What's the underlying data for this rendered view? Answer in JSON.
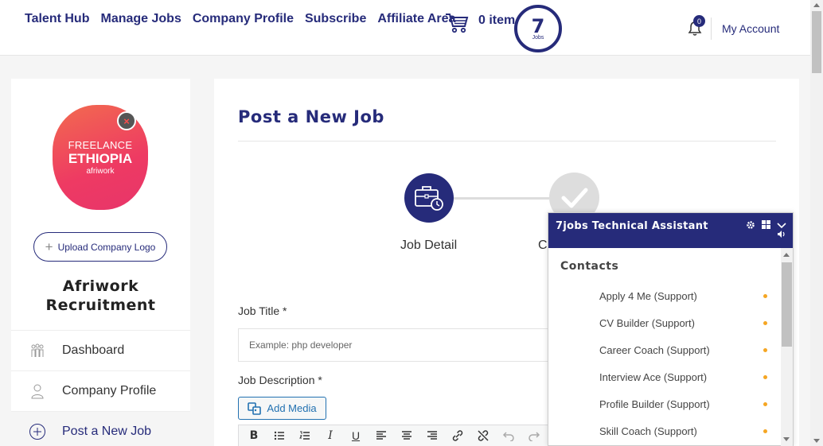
{
  "header": {
    "nav": [
      "Talent Hub",
      "Manage Jobs",
      "Company Profile",
      "Subscribe",
      "Affiliate Area"
    ],
    "cart_text": "0 item",
    "logo_number": "7",
    "logo_text": "Jobs",
    "notification_count": "0",
    "account_label": "My Account"
  },
  "sidebar": {
    "company_logo": {
      "line1": "FREELANCE",
      "line2": "ETHIOPIA",
      "line3": "afriwork"
    },
    "remove_logo_symbol": "×",
    "upload_button": "Upload Company Logo",
    "company_name_line1": "Afriwork",
    "company_name_line2": "Recruitment",
    "menu": [
      {
        "label": "Dashboard",
        "icon": "team-icon"
      },
      {
        "label": "Company Profile",
        "icon": "user-icon"
      },
      {
        "label": "Post a New Job",
        "icon": "plus-circle-icon"
      }
    ]
  },
  "main": {
    "title": "Post a New Job",
    "steps": [
      {
        "label": "Job Detail",
        "state": "active"
      },
      {
        "label": "C",
        "state": "complete"
      }
    ],
    "job_title_label": "Job Title *",
    "job_title_placeholder": "Example: php developer",
    "job_description_label": "Job Description *",
    "add_media_label": "Add Media",
    "toolbar": [
      "bold",
      "bullet-list",
      "numbered-list",
      "italic",
      "underline",
      "align-left",
      "align-center",
      "align-right",
      "link",
      "unlink",
      "undo",
      "redo"
    ]
  },
  "chat": {
    "title": "7jobs Technical Assistant",
    "contacts_title": "Contacts",
    "contacts": [
      "Apply 4 Me (Support)",
      "CV Builder (Support)",
      "Career Coach (Support)",
      "Interview Ace (Support)",
      "Profile Builder (Support)",
      "Skill Coach (Support)"
    ],
    "status_color": "#f5a623"
  },
  "colors": {
    "brand": "#262b7a",
    "logo_gradient_start": "#f26b4f",
    "logo_gradient_end": "#e7356a"
  }
}
